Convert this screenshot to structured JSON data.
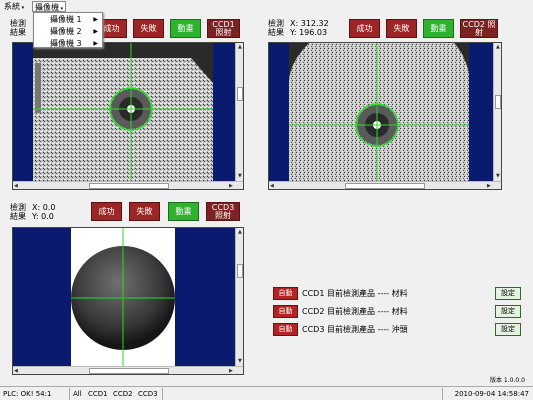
{
  "menubar": {
    "items": [
      {
        "label": "系統"
      },
      {
        "label": "攝像機"
      }
    ],
    "dropdown": [
      {
        "label": "攝像機 1"
      },
      {
        "label": "攝像機 2"
      },
      {
        "label": "攝像機 3"
      }
    ]
  },
  "panels": [
    {
      "label_top": "檢測",
      "label_bottom": "結果",
      "x_value": "",
      "y_value": "",
      "buttons": {
        "success": "成功",
        "fail": "失敗",
        "auto": "動畫",
        "ccd": "CCD1 照射"
      }
    },
    {
      "label_top": "檢測",
      "label_bottom": "結果",
      "x_value": "X: 312.32",
      "y_value": "Y: 196.03",
      "buttons": {
        "success": "成功",
        "fail": "失敗",
        "auto": "動畫",
        "ccd": "CCD2 照射"
      }
    },
    {
      "label_top": "檢測",
      "label_bottom": "結果",
      "x_value": "X: 0.0",
      "y_value": "Y: 0.0",
      "buttons": {
        "success": "成功",
        "fail": "失敗",
        "auto": "動畫",
        "ccd": "CCD3 照射"
      }
    }
  ],
  "status_rows": [
    {
      "button": "自動",
      "text": "CCD1 目前檢測產品 ---- 材料",
      "set": "設定"
    },
    {
      "button": "自動",
      "text": "CCD2 目前檢測產品 ---- 材料",
      "set": "設定"
    },
    {
      "button": "自動",
      "text": "CCD3 目前檢測產品 ---- 沖頭",
      "set": "設定"
    }
  ],
  "version": "版本 1.0.0.0",
  "statusbar": {
    "plc": "PLC: OK! 54:1",
    "all": "All",
    "ccd1": "CCD1",
    "ccd2": "CCD2",
    "ccd3": "CCD3",
    "datetime": "2010-09-04 14:58:47"
  },
  "colors": {
    "success_btn": "#9c2626",
    "auto_btn": "#2fb32f",
    "crosshair": "#22dd22",
    "frame": "#0a1a6e"
  }
}
